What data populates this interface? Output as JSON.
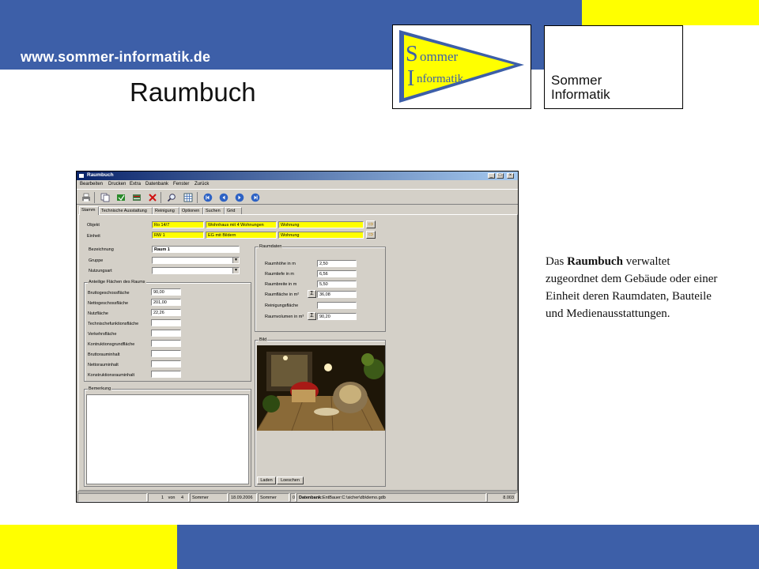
{
  "slide": {
    "url": "www.sommer-informatik.de",
    "title": "Raumbuch",
    "logo_flag": {
      "line1": "ommer",
      "line2": "nformatik",
      "initial1": "S",
      "initial2": "I"
    },
    "logo_text": {
      "line1": "Sommer",
      "line2": "Informatik"
    },
    "description": {
      "prefix": "Das ",
      "bold": "Raumbuch",
      "suffix": " verwaltet zugeordnet dem Gebäude oder einer Einheit deren Raumdaten, Bauteile und Medienausstattungen."
    },
    "colors": {
      "blue": "#3d5fa8",
      "yellow": "#ffff00"
    }
  },
  "window": {
    "title": "Raumbuch",
    "menu": [
      "Bearbeiten",
      "Drucken",
      "Extra",
      "Datenbank",
      "Fenster",
      "Zurück"
    ],
    "tabs": [
      "Stamm",
      "Technische Ausstattung",
      "Reinigung",
      "Optionen",
      "Suchen",
      "Grid"
    ],
    "active_tab": "Stamm",
    "header": {
      "objekt_label": "Objekt",
      "objekt": [
        "Ro 14/7",
        "Wohnhaus mit 4 Wohnungen",
        "Wohnung"
      ],
      "einheit_label": "Einheit",
      "einheit": [
        "RW 1",
        "EG mit Bildern",
        "Wohnung"
      ]
    },
    "left": {
      "bezeichnung_label": "Bezeichnung",
      "bezeichnung": "Raum 1",
      "gruppe_label": "Gruppe",
      "nutzungsart_label": "Nutzungsart",
      "group_title": "Anteilige Flächen des Raums",
      "rows": [
        {
          "label": "Bruttogeschossfläche",
          "value": "90,00"
        },
        {
          "label": "Nettogeschossfläche",
          "value": "201,00"
        },
        {
          "label": "Nutzfläche",
          "value": "22,26"
        },
        {
          "label": "Technischefunktionsfläche",
          "value": ""
        },
        {
          "label": "Verkehrsfläche",
          "value": ""
        },
        {
          "label": "Kontruktionsgrundfläche",
          "value": ""
        },
        {
          "label": "Bruttorauminhalt",
          "value": ""
        },
        {
          "label": "Nettorauminhalt",
          "value": ""
        },
        {
          "label": "Konstruktionsrauminhalt",
          "value": ""
        }
      ],
      "bemerkung_title": "Bemerkung"
    },
    "raumdaten": {
      "title": "Raumdaten",
      "rows": [
        {
          "label": "Raumhöhe in m",
          "value": "2,50"
        },
        {
          "label": "Raumtiefe in m",
          "value": "6,56"
        },
        {
          "label": "Raumbreite in m",
          "value": "5,50"
        },
        {
          "label": "Raumfläche in m²",
          "value": "36,08"
        },
        {
          "label": "Reinigungsfläche",
          "value": ""
        },
        {
          "label": "Raumvolumen in m³",
          "value": "90,20"
        }
      ],
      "sigma": "Σ"
    },
    "bild": {
      "title": "Bild",
      "laden": "Laden",
      "loeschen": "Loeschen"
    },
    "status": {
      "record": "1",
      "von": "von",
      "total": "4",
      "user": "Sommer",
      "date": "18.09.2006",
      "user2": "Sommer",
      "zero": "0",
      "db_label": "Datenbank:",
      "db_path": "EntBauer:C:\\sicher\\db\\demo.gdb",
      "version": "8.003"
    }
  }
}
